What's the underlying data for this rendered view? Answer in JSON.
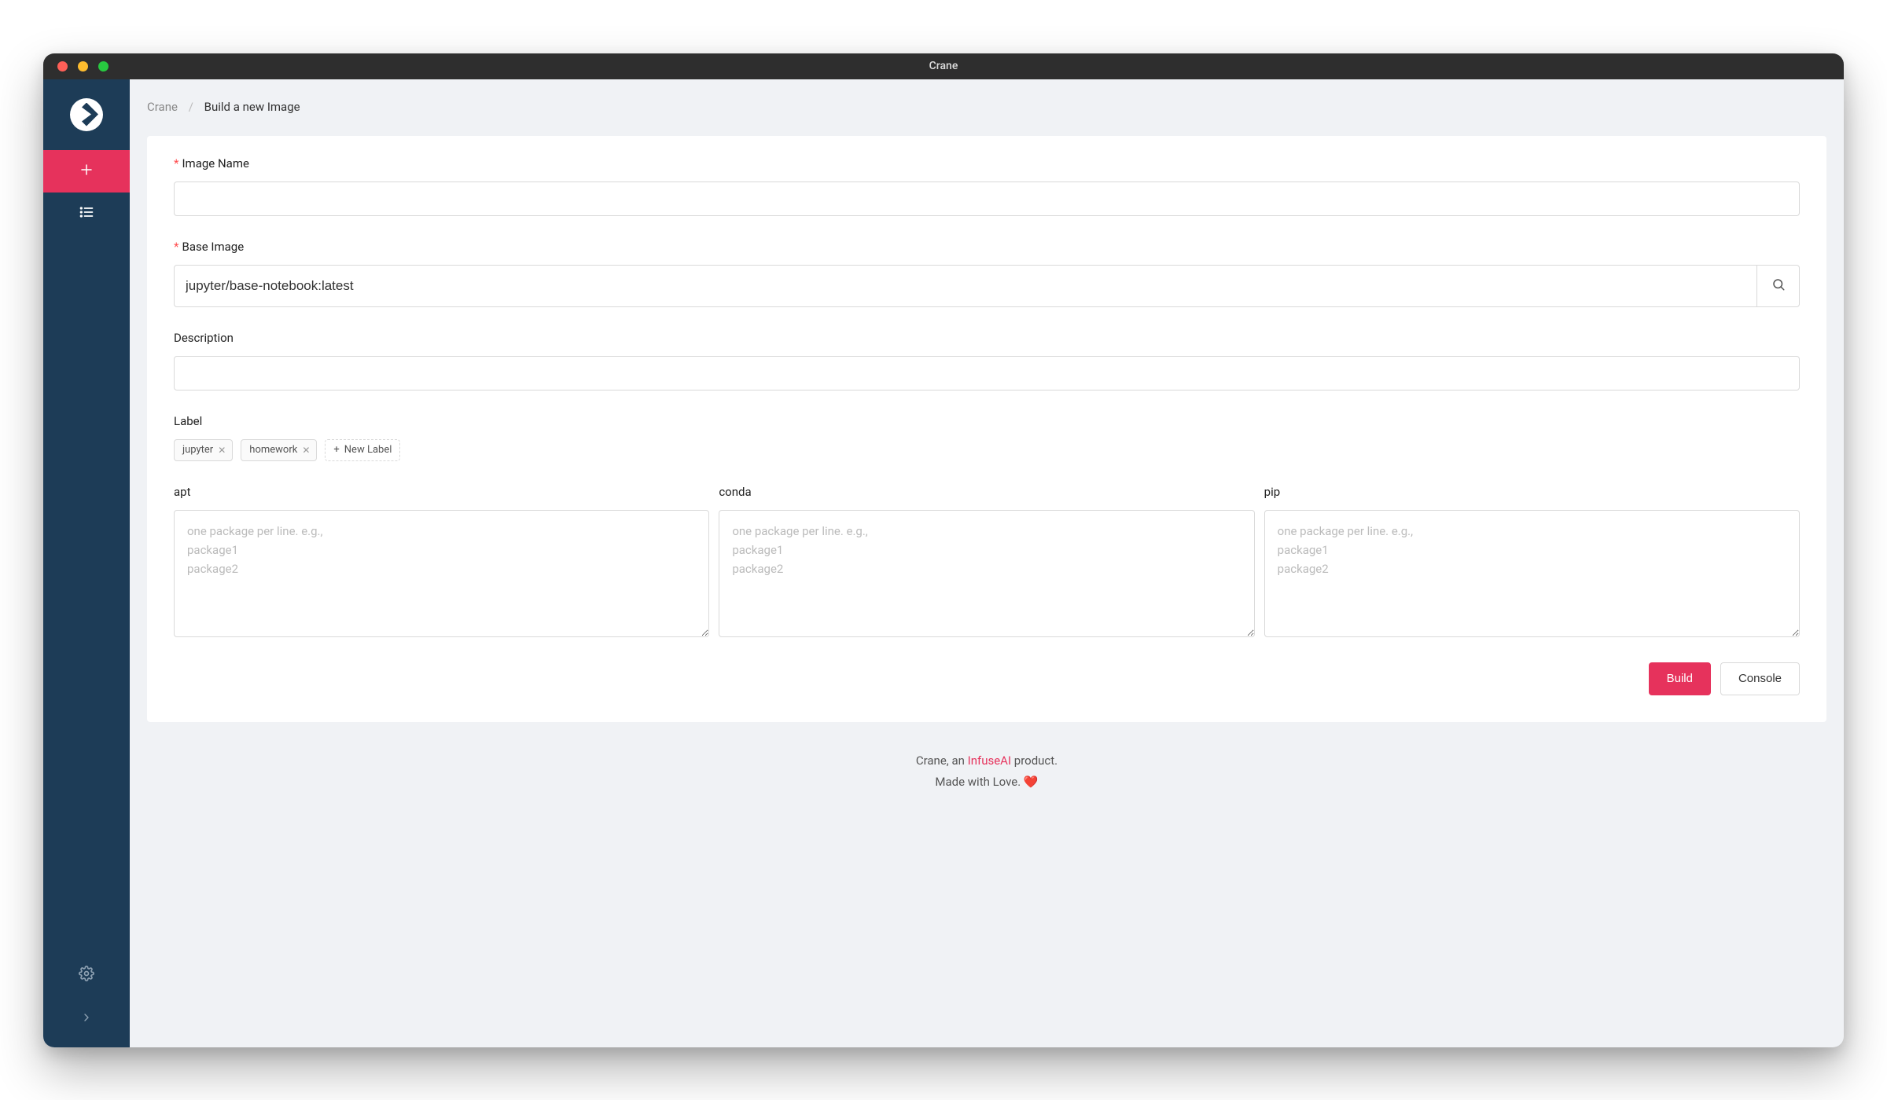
{
  "window": {
    "title": "Crane"
  },
  "breadcrumb": {
    "root": "Crane",
    "leaf": "Build a new Image"
  },
  "form": {
    "image_name": {
      "label": "Image Name",
      "value": "",
      "required": true
    },
    "base_image": {
      "label": "Base Image",
      "value": "jupyter/base-notebook:latest",
      "required": true
    },
    "description": {
      "label": "Description",
      "value": "",
      "required": false
    },
    "label": {
      "label": "Label",
      "tags": [
        "jupyter",
        "homework"
      ],
      "new_tag_label": "New Label"
    },
    "packages": {
      "apt": {
        "label": "apt",
        "placeholder": "one package per line. e.g.,\npackage1\npackage2",
        "value": ""
      },
      "conda": {
        "label": "conda",
        "placeholder": "one package per line. e.g.,\npackage1\npackage2",
        "value": ""
      },
      "pip": {
        "label": "pip",
        "placeholder": "one package per line. e.g.,\npackage1\npackage2",
        "value": ""
      }
    }
  },
  "actions": {
    "build": "Build",
    "console": "Console"
  },
  "footer": {
    "line1_pre": "Crane, an ",
    "line1_link": "InfuseAI",
    "line1_post": " product.",
    "line2": "Made with Love. ❤️"
  }
}
